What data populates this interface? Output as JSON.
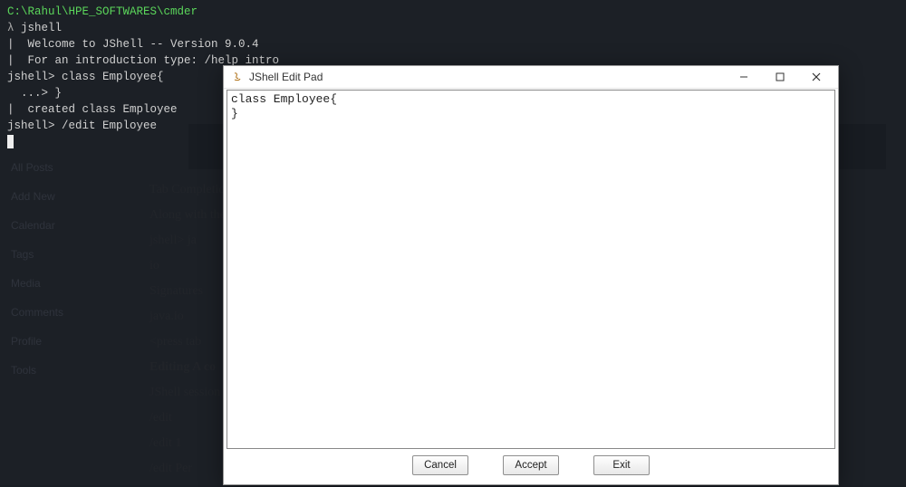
{
  "terminal": {
    "path": "C:\\Rahul\\HPE_SOFTWARES\\cmder",
    "lambda": "λ",
    "cmd": "jshell",
    "lines": [
      "|  Welcome to JShell -- Version 9.0.4",
      "|  For an introduction type: /help intro",
      "",
      "jshell> class Employee{",
      "  ...> }",
      "|  created class Employee",
      "",
      "jshell> /edit Employee"
    ]
  },
  "bgSidebar": {
    "items": [
      "All Posts",
      "Add New",
      "Calendar",
      "Tags",
      "Media",
      "Comments",
      "Profile",
      "Tools"
    ]
  },
  "bgContent": {
    "lines": [
      "Tab Completion",
      "Along with the",
      "jshell> ja",
      "io",
      "Signatures",
      "java.io",
      "<press tab",
      "Editing A co",
      "JShell session",
      "/edit",
      "/edit 1",
      "/edit Per"
    ]
  },
  "dialog": {
    "title": "JShell Edit Pad",
    "editor": "class Employee{\n}",
    "buttons": {
      "cancel": "Cancel",
      "accept": "Accept",
      "exit": "Exit"
    }
  }
}
